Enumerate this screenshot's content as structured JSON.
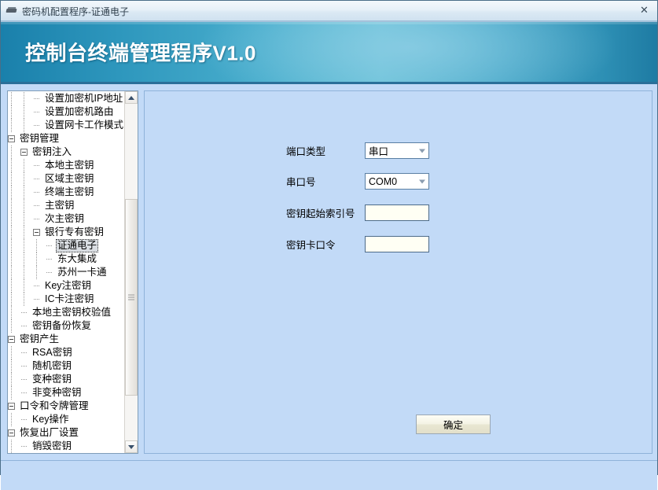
{
  "window": {
    "title": "密码机配置程序-证通电子",
    "close_label": "✕",
    "banner_title": "控制台终端管理程序V1.0",
    "icon": "window-icon"
  },
  "tree": {
    "items": [
      {
        "label": "设置加密机IP地址",
        "depth": 2,
        "marker": "dash",
        "selected": false
      },
      {
        "label": "设置加密机路由",
        "depth": 2,
        "marker": "dash",
        "selected": false
      },
      {
        "label": "设置网卡工作模式",
        "depth": 2,
        "marker": "dash",
        "selected": false
      },
      {
        "label": "密钥管理",
        "depth": 0,
        "marker": "minus",
        "selected": false
      },
      {
        "label": "密钥注入",
        "depth": 1,
        "marker": "minus",
        "selected": false
      },
      {
        "label": "本地主密钥",
        "depth": 2,
        "marker": "dash",
        "selected": false
      },
      {
        "label": "区域主密钥",
        "depth": 2,
        "marker": "dash",
        "selected": false
      },
      {
        "label": "终端主密钥",
        "depth": 2,
        "marker": "dash",
        "selected": false
      },
      {
        "label": "主密钥",
        "depth": 2,
        "marker": "dash",
        "selected": false
      },
      {
        "label": "次主密钥",
        "depth": 2,
        "marker": "dash",
        "selected": false
      },
      {
        "label": "银行专有密钥",
        "depth": 2,
        "marker": "minus",
        "selected": false
      },
      {
        "label": "证通电子",
        "depth": 3,
        "marker": "dash",
        "selected": true
      },
      {
        "label": "东大集成",
        "depth": 3,
        "marker": "dash",
        "selected": false
      },
      {
        "label": "苏州一卡通",
        "depth": 3,
        "marker": "dash",
        "selected": false
      },
      {
        "label": "Key注密钥",
        "depth": 2,
        "marker": "dash",
        "selected": false
      },
      {
        "label": "IC卡注密钥",
        "depth": 2,
        "marker": "dash",
        "selected": false
      },
      {
        "label": "本地主密钥校验值",
        "depth": 1,
        "marker": "dash",
        "selected": false
      },
      {
        "label": "密钥备份恢复",
        "depth": 1,
        "marker": "dash",
        "selected": false
      },
      {
        "label": "密钥产生",
        "depth": 0,
        "marker": "minus",
        "selected": false
      },
      {
        "label": "RSA密钥",
        "depth": 1,
        "marker": "dash",
        "selected": false
      },
      {
        "label": "随机密钥",
        "depth": 1,
        "marker": "dash",
        "selected": false
      },
      {
        "label": "变种密钥",
        "depth": 1,
        "marker": "dash",
        "selected": false
      },
      {
        "label": "非变种密钥",
        "depth": 1,
        "marker": "dash",
        "selected": false
      },
      {
        "label": "口令和令牌管理",
        "depth": 0,
        "marker": "minus",
        "selected": false
      },
      {
        "label": "Key操作",
        "depth": 1,
        "marker": "dash",
        "selected": false
      },
      {
        "label": "恢复出厂设置",
        "depth": 0,
        "marker": "minus",
        "selected": false
      },
      {
        "label": "销毁密钥",
        "depth": 1,
        "marker": "dash",
        "selected": false
      }
    ],
    "scrollbar": {
      "up_arrow": "scroll-up",
      "down_arrow": "scroll-down"
    }
  },
  "form": {
    "fields": [
      {
        "label": "端口类型",
        "type": "combo",
        "value": "串口"
      },
      {
        "label": "串口号",
        "type": "combo",
        "value": "COM0"
      },
      {
        "label": "密钥起始索引号",
        "type": "text",
        "value": "",
        "placeholder": ""
      },
      {
        "label": "密钥卡口令",
        "type": "text",
        "value": "",
        "placeholder": ""
      }
    ],
    "submit_label": "确定"
  },
  "colors": {
    "window_bg": "#c2daf7",
    "banner_from": "#1a80ab",
    "banner_to": "#69c2d8",
    "tree_bg": "#ffffff",
    "selection": "#d9dde2",
    "input_border": "#4d6b8a"
  }
}
